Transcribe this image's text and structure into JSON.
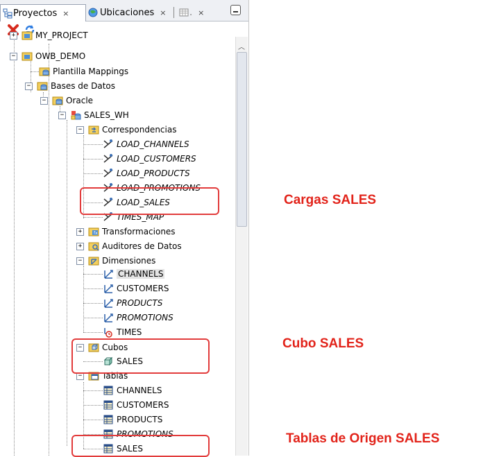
{
  "tabs": [
    {
      "label": "Proyectos",
      "close": "×"
    },
    {
      "label": "Ubicaciones",
      "close": "×"
    },
    {
      "label": ".",
      "close": "×"
    }
  ],
  "tree": [
    {
      "label": "MY_PROJECT",
      "italic": false
    },
    {
      "label": "OWB_DEMO",
      "italic": false
    },
    {
      "label": "Plantilla Mappings",
      "italic": false
    },
    {
      "label": "Bases de Datos",
      "italic": false
    },
    {
      "label": "Oracle",
      "italic": false
    },
    {
      "label": "SALES_WH",
      "italic": false
    },
    {
      "label": "Correspondencias",
      "italic": false
    },
    {
      "label": "LOAD_CHANNELS",
      "italic": true
    },
    {
      "label": "LOAD_CUSTOMERS",
      "italic": true
    },
    {
      "label": "LOAD_PRODUCTS",
      "italic": true
    },
    {
      "label": "LOAD_PROMOTIONS",
      "italic": true
    },
    {
      "label": "LOAD_SALES",
      "italic": true
    },
    {
      "label": "TIMES_MAP",
      "italic": true
    },
    {
      "label": "Transformaciones",
      "italic": false
    },
    {
      "label": "Auditores de Datos",
      "italic": false
    },
    {
      "label": "Dimensiones",
      "italic": false
    },
    {
      "label": "CHANNELS",
      "italic": false
    },
    {
      "label": "CUSTOMERS",
      "italic": false
    },
    {
      "label": "PRODUCTS",
      "italic": true
    },
    {
      "label": "PROMOTIONS",
      "italic": true
    },
    {
      "label": "TIMES",
      "italic": false
    },
    {
      "label": "Cubos",
      "italic": false
    },
    {
      "label": "SALES",
      "italic": false
    },
    {
      "label": "Tablas",
      "italic": false
    },
    {
      "label": "CHANNELS",
      "italic": false
    },
    {
      "label": "CUSTOMERS",
      "italic": false
    },
    {
      "label": "PRODUCTS",
      "italic": false
    },
    {
      "label": "PROMOTIONS",
      "italic": true
    },
    {
      "label": "SALES",
      "italic": false
    }
  ],
  "annotations": {
    "cargas": "Cargas SALES",
    "cubo": "Cubo SALES",
    "tablas": "Tablas de Origen SALES"
  },
  "colors": {
    "highlight": "#e23b3b",
    "annotation": "#e2231a"
  }
}
